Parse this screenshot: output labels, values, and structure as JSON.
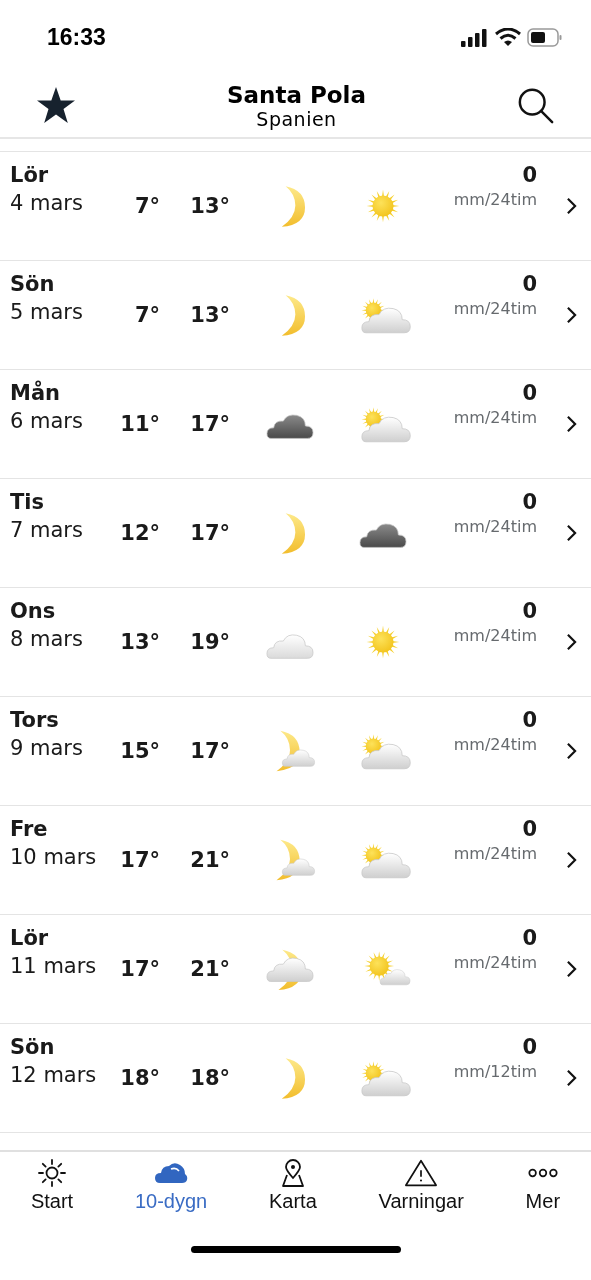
{
  "status_bar": {
    "time": "16:33"
  },
  "header": {
    "title": "Santa Pola",
    "subtitle": "Spanien"
  },
  "days": [
    {
      "day": "Lör",
      "date": "4 mars",
      "low": "7°",
      "high": "13°",
      "night": {
        "kind": "moon"
      },
      "daytime": {
        "kind": "sun"
      },
      "precipitation": "0",
      "unit": "mm/24tim"
    },
    {
      "day": "Sön",
      "date": "5 mars",
      "low": "7°",
      "high": "13°",
      "night": {
        "kind": "moon"
      },
      "daytime": {
        "kind": "sun-cloud"
      },
      "precipitation": "0",
      "unit": "mm/24tim"
    },
    {
      "day": "Mån",
      "date": "6 mars",
      "low": "11°",
      "high": "17°",
      "night": {
        "kind": "dark-cloud"
      },
      "daytime": {
        "kind": "sun-cloud"
      },
      "precipitation": "0",
      "unit": "mm/24tim"
    },
    {
      "day": "Tis",
      "date": "7 mars",
      "low": "12°",
      "high": "17°",
      "night": {
        "kind": "moon"
      },
      "daytime": {
        "kind": "dark-cloud"
      },
      "precipitation": "0",
      "unit": "mm/24tim"
    },
    {
      "day": "Ons",
      "date": "8 mars",
      "low": "13°",
      "high": "19°",
      "night": {
        "kind": "cloud"
      },
      "daytime": {
        "kind": "sun"
      },
      "precipitation": "0",
      "unit": "mm/24tim"
    },
    {
      "day": "Tors",
      "date": "9 mars",
      "low": "15°",
      "high": "17°",
      "night": {
        "kind": "moon-cloud"
      },
      "daytime": {
        "kind": "sun-cloud"
      },
      "precipitation": "0",
      "unit": "mm/24tim"
    },
    {
      "day": "Fre",
      "date": "10 mars",
      "low": "17°",
      "high": "21°",
      "night": {
        "kind": "moon-cloud"
      },
      "daytime": {
        "kind": "sun-cloud"
      },
      "precipitation": "0",
      "unit": "mm/24tim"
    },
    {
      "day": "Lör",
      "date": "11 mars",
      "low": "17°",
      "high": "21°",
      "night": {
        "kind": "cloud-moon"
      },
      "daytime": {
        "kind": "sun-small-cloud"
      },
      "precipitation": "0",
      "unit": "mm/24tim"
    },
    {
      "day": "Sön",
      "date": "12 mars",
      "low": "18°",
      "high": "18°",
      "night": {
        "kind": "moon"
      },
      "daytime": {
        "kind": "sun-cloud"
      },
      "precipitation": "0",
      "unit": "mm/12tim"
    }
  ],
  "tabs": [
    {
      "label": "Start",
      "kind": "sun",
      "selected": false
    },
    {
      "label": "10-dygn",
      "kind": "cloud",
      "selected": true
    },
    {
      "label": "Karta",
      "kind": "map",
      "selected": false
    },
    {
      "label": "Varningar",
      "kind": "warning",
      "selected": false
    },
    {
      "label": "Mer",
      "kind": "more",
      "selected": false
    }
  ]
}
